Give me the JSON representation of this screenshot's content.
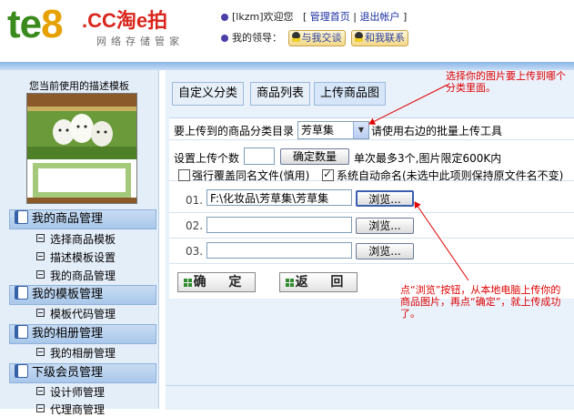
{
  "header": {
    "logo_main": "te8",
    "logo_cc": ".CC淘e拍",
    "logo_sub": "网络存储管家",
    "welcome_user": "[lkzm]欢迎您",
    "link_admin_home": "管理首页",
    "link_logout": "退出帐户",
    "leader_label": "我的领导：",
    "btn_chat": "与我交谈",
    "btn_contact": "和我联系"
  },
  "sidebar": {
    "template_title": "您当前使用的描述模板",
    "groups": [
      {
        "label": "我的商品管理",
        "items": [
          "选择商品模板",
          "描述模板设置",
          "我的商品管理"
        ]
      },
      {
        "label": "我的模板管理",
        "items": [
          "模板代码管理"
        ]
      },
      {
        "label": "我的相册管理",
        "items": [
          "我的相册管理"
        ]
      },
      {
        "label": "下级会员管理",
        "items": [
          "设计师管理",
          "代理商管理"
        ]
      }
    ]
  },
  "tabs": [
    "自定义分类",
    "商品列表",
    "上传商品图"
  ],
  "form": {
    "category_label": "要上传到的商品分类目录",
    "category_value": "芳草集",
    "category_hint": "请使用右边的批量上传工具",
    "count_label": "设置上传个数",
    "count_value": "",
    "confirm_count": "确定数量",
    "count_hint": "单次最多3个,图片限定600K内",
    "overwrite_label": "强行覆盖同名文件(慎用)",
    "overwrite_checked": false,
    "autoname_label": "系统自动命名(未选中此项则保持原文件名不变)",
    "autoname_checked": true,
    "files": [
      {
        "num": "01.",
        "value": "F:\\化妆品\\芳草集\\芳草集",
        "browse": "浏览..."
      },
      {
        "num": "02.",
        "value": "",
        "browse": "浏览..."
      },
      {
        "num": "03.",
        "value": "",
        "browse": "浏览..."
      }
    ],
    "ok_label": "确 定",
    "back_label": "返 回"
  },
  "annotations": {
    "top": "选择你的图片要上传到哪个分类里面。",
    "bottom": "点“浏览”按钮，从本地电脑上传你的商品图片，再点“确定”，就上传成功了。"
  },
  "colors": {
    "annotation": "#e00000",
    "panel_bg": "#e9f1fb",
    "sidebar_bg": "#e4eef9",
    "group_header": "#b9d2ee"
  }
}
